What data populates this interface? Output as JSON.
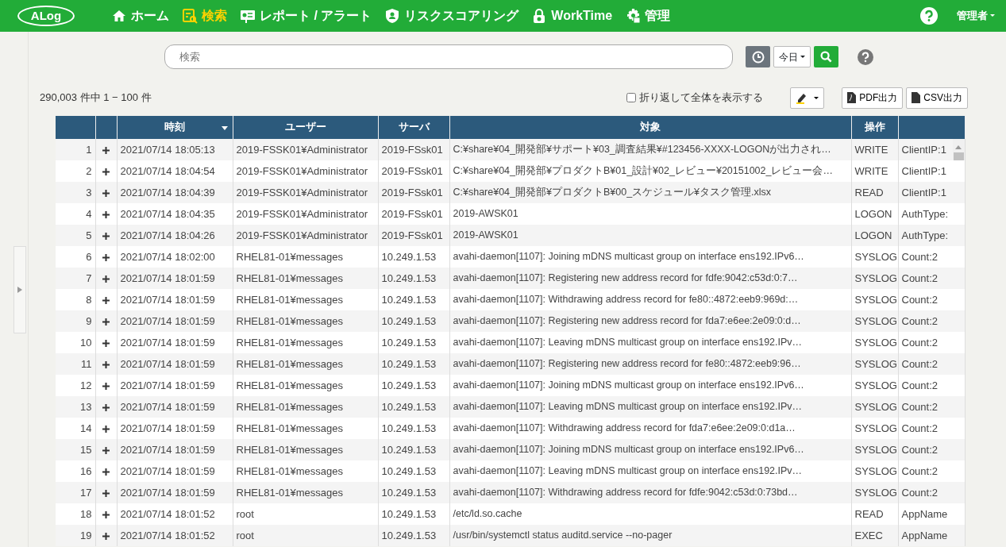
{
  "navbar": {
    "logo": "ALog",
    "items": [
      {
        "label": "ホーム",
        "selected": false
      },
      {
        "label": "検索",
        "selected": true
      },
      {
        "label": "レポート / アラート",
        "selected": false
      },
      {
        "label": "リスクスコアリング",
        "selected": false
      },
      {
        "label": "WorkTime",
        "selected": false
      },
      {
        "label": "管理",
        "selected": false
      }
    ],
    "user_menu": "管理者"
  },
  "search": {
    "placeholder": "検索",
    "period": "今日"
  },
  "result_count": "290,003 件中 1 − 100 件",
  "wrap_option": {
    "label": "折り返して全体を表示する",
    "checked": false
  },
  "export_buttons": [
    "PDF出力",
    "CSV出力"
  ],
  "table": {
    "columns": [
      "",
      "",
      "時刻",
      "ユーザー",
      "サーバ",
      "対象",
      "操作",
      ""
    ],
    "rows": [
      {
        "no": "1",
        "time": "2021/07/14 18:05:13",
        "user": "2019-FSSK01¥Administrator",
        "server": "2019-FSsk01",
        "target": "C:¥share¥04_開発部¥サポート¥03_調査結果¥#123456-XXXX-LOGONが出力され…",
        "operation": "WRITE",
        "column_8": "ClientIP:1"
      },
      {
        "no": "2",
        "time": "2021/07/14 18:04:54",
        "user": "2019-FSSK01¥Administrator",
        "server": "2019-FSsk01",
        "target": "C:¥share¥04_開発部¥プロダクトB¥01_設計¥02_レビュー¥20151002_レビュー会…",
        "operation": "WRITE",
        "column_8": "ClientIP:1"
      },
      {
        "no": "3",
        "time": "2021/07/14 18:04:39",
        "user": "2019-FSSK01¥Administrator",
        "server": "2019-FSsk01",
        "target": "C:¥share¥04_開発部¥プロダクトB¥00_スケジュール¥タスク管理.xlsx",
        "operation": "READ",
        "column_8": "ClientIP:1"
      },
      {
        "no": "4",
        "time": "2021/07/14 18:04:35",
        "user": "2019-FSSK01¥Administrator",
        "server": "2019-FSsk01",
        "target": "2019-AWSK01",
        "operation": "LOGON",
        "column_8": "AuthType:"
      },
      {
        "no": "5",
        "time": "2021/07/14 18:04:26",
        "user": "2019-FSSK01¥Administrator",
        "server": "2019-FSsk01",
        "target": "2019-AWSK01",
        "operation": "LOGON",
        "column_8": "AuthType:"
      },
      {
        "no": "6",
        "time": "2021/07/14 18:02:00",
        "user": "RHEL81-01¥messages",
        "server": "10.249.1.53",
        "target": "avahi-daemon[1107]: Joining mDNS multicast group on interface ens192.IPv6…",
        "operation": "SYSLOG",
        "column_8": "Count:2"
      },
      {
        "no": "7",
        "time": "2021/07/14 18:01:59",
        "user": "RHEL81-01¥messages",
        "server": "10.249.1.53",
        "target": "avahi-daemon[1107]: Registering new address record for fdfe:9042:c53d:0:7…",
        "operation": "SYSLOG",
        "column_8": "Count:2"
      },
      {
        "no": "8",
        "time": "2021/07/14 18:01:59",
        "user": "RHEL81-01¥messages",
        "server": "10.249.1.53",
        "target": "avahi-daemon[1107]: Withdrawing address record for fe80::4872:eeb9:969d:…",
        "operation": "SYSLOG",
        "column_8": "Count:2"
      },
      {
        "no": "9",
        "time": "2021/07/14 18:01:59",
        "user": "RHEL81-01¥messages",
        "server": "10.249.1.53",
        "target": "avahi-daemon[1107]: Registering new address record for fda7:e6ee:2e09:0:d…",
        "operation": "SYSLOG",
        "column_8": "Count:2"
      },
      {
        "no": "10",
        "time": "2021/07/14 18:01:59",
        "user": "RHEL81-01¥messages",
        "server": "10.249.1.53",
        "target": "avahi-daemon[1107]: Leaving mDNS multicast group on interface ens192.IPv…",
        "operation": "SYSLOG",
        "column_8": "Count:2"
      },
      {
        "no": "11",
        "time": "2021/07/14 18:01:59",
        "user": "RHEL81-01¥messages",
        "server": "10.249.1.53",
        "target": "avahi-daemon[1107]: Registering new address record for fe80::4872:eeb9:96…",
        "operation": "SYSLOG",
        "column_8": "Count:2"
      },
      {
        "no": "12",
        "time": "2021/07/14 18:01:59",
        "user": "RHEL81-01¥messages",
        "server": "10.249.1.53",
        "target": "avahi-daemon[1107]: Joining mDNS multicast group on interface ens192.IPv6…",
        "operation": "SYSLOG",
        "column_8": "Count:2"
      },
      {
        "no": "13",
        "time": "2021/07/14 18:01:59",
        "user": "RHEL81-01¥messages",
        "server": "10.249.1.53",
        "target": "avahi-daemon[1107]: Leaving mDNS multicast group on interface ens192.IPv…",
        "operation": "SYSLOG",
        "column_8": "Count:2"
      },
      {
        "no": "14",
        "time": "2021/07/14 18:01:59",
        "user": "RHEL81-01¥messages",
        "server": "10.249.1.53",
        "target": "avahi-daemon[1107]: Withdrawing address record for fda7:e6ee:2e09:0:d1a…",
        "operation": "SYSLOG",
        "column_8": "Count:2"
      },
      {
        "no": "15",
        "time": "2021/07/14 18:01:59",
        "user": "RHEL81-01¥messages",
        "server": "10.249.1.53",
        "target": "avahi-daemon[1107]: Joining mDNS multicast group on interface ens192.IPv6…",
        "operation": "SYSLOG",
        "column_8": "Count:2"
      },
      {
        "no": "16",
        "time": "2021/07/14 18:01:59",
        "user": "RHEL81-01¥messages",
        "server": "10.249.1.53",
        "target": "avahi-daemon[1107]: Leaving mDNS multicast group on interface ens192.IPv…",
        "operation": "SYSLOG",
        "column_8": "Count:2"
      },
      {
        "no": "17",
        "time": "2021/07/14 18:01:59",
        "user": "RHEL81-01¥messages",
        "server": "10.249.1.53",
        "target": "avahi-daemon[1107]: Withdrawing address record for fdfe:9042:c53d:0:73bd…",
        "operation": "SYSLOG",
        "column_8": "Count:2"
      },
      {
        "no": "18",
        "time": "2021/07/14 18:01:52",
        "user": "root",
        "server": "10.249.1.53",
        "target": "/etc/ld.so.cache",
        "operation": "READ",
        "column_8": "AppName"
      },
      {
        "no": "19",
        "time": "2021/07/14 18:01:52",
        "user": "root",
        "server": "10.249.1.53",
        "target": "/usr/bin/systemctl status auditd.service --no-pager",
        "operation": "EXEC",
        "column_8": "AppName"
      }
    ]
  }
}
